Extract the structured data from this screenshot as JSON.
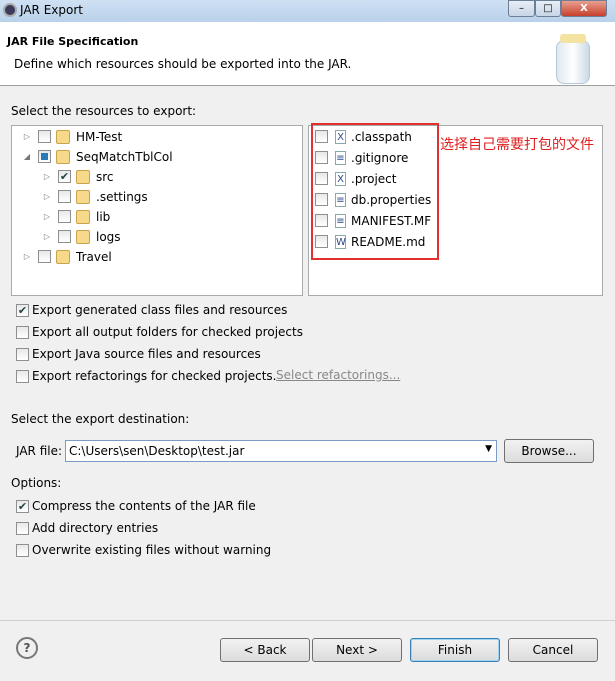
{
  "window": {
    "title": "JAR Export",
    "minimize": "–",
    "maximize": "□",
    "close": "X"
  },
  "header": {
    "title": "JAR File Specification",
    "description": "Define which resources should be exported into the JAR."
  },
  "resources_label": "Select the resources to export:",
  "tree": [
    {
      "label": "HM-Test",
      "checked": false
    },
    {
      "label": "SeqMatchTblCol",
      "checked": "partial"
    },
    {
      "label": "src",
      "checked": true
    },
    {
      "label": ".settings",
      "checked": false
    },
    {
      "label": "lib",
      "checked": false
    },
    {
      "label": "logs",
      "checked": false
    },
    {
      "label": "Travel",
      "checked": false
    }
  ],
  "files": [
    {
      "label": ".classpath",
      "icon": "xml-file-icon"
    },
    {
      "label": ".gitignore",
      "icon": "text-file-icon"
    },
    {
      "label": ".project",
      "icon": "xml-file-icon"
    },
    {
      "label": "db.properties",
      "icon": "text-file-icon"
    },
    {
      "label": "MANIFEST.MF",
      "icon": "text-file-icon"
    },
    {
      "label": "README.md",
      "icon": "word-file-icon"
    }
  ],
  "annotation": "选择自己需要打包的文件",
  "annotation_color": "#e02020",
  "export_options": [
    {
      "label": "Export generated class files and resources",
      "checked": true
    },
    {
      "label": "Export all output folders for checked projects",
      "checked": false
    },
    {
      "label": "Export Java source files and resources",
      "checked": false
    },
    {
      "label": "Export refactorings for checked projects.",
      "checked": false
    }
  ],
  "select_refactorings": "Select refactorings...",
  "destination_label": "Select the export destination:",
  "jar_file_label": "JAR file:",
  "jar_file_value": "C:\\Users\\sen\\Desktop\\test.jar",
  "browse": "Browse...",
  "options_label": "Options:",
  "options": [
    {
      "label": "Compress the contents of the JAR file",
      "checked": true
    },
    {
      "label": "Add directory entries",
      "checked": false
    },
    {
      "label": "Overwrite existing files without warning",
      "checked": false
    }
  ],
  "buttons": {
    "help": "?",
    "back": "< Back",
    "next": "Next >",
    "finish": "Finish",
    "cancel": "Cancel"
  }
}
